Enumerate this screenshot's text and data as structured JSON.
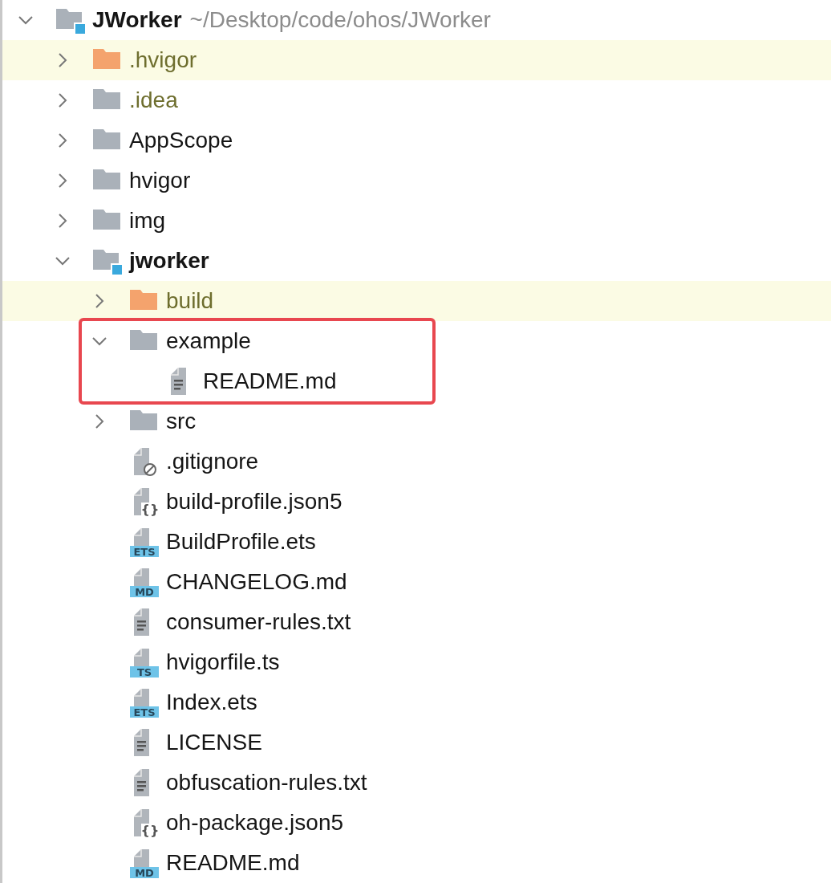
{
  "tree": {
    "name": "JWorker",
    "path": "~/Desktop/code/ohos/JWorker",
    "kind": "module",
    "excluded": false,
    "ignored": false,
    "expanded": true,
    "children": [
      {
        "name": ".hvigor",
        "kind": "folder",
        "excluded": true,
        "ignored": false,
        "expanded": false
      },
      {
        "name": ".idea",
        "kind": "folder",
        "excluded": false,
        "ignored": true,
        "expanded": false
      },
      {
        "name": "AppScope",
        "kind": "folder",
        "excluded": false,
        "ignored": false,
        "expanded": false
      },
      {
        "name": "hvigor",
        "kind": "folder",
        "excluded": false,
        "ignored": false,
        "expanded": false
      },
      {
        "name": "img",
        "kind": "folder",
        "excluded": false,
        "ignored": false,
        "expanded": false
      },
      {
        "name": "jworker",
        "kind": "module",
        "excluded": false,
        "ignored": false,
        "expanded": true,
        "children": [
          {
            "name": "build",
            "kind": "folder",
            "excluded": true,
            "ignored": false,
            "expanded": false
          },
          {
            "name": "example",
            "kind": "folder",
            "excluded": false,
            "ignored": false,
            "expanded": true,
            "boxed": true,
            "children": [
              {
                "name": "README.md",
                "kind": "textfile"
              }
            ]
          },
          {
            "name": "src",
            "kind": "folder",
            "excluded": false,
            "ignored": false,
            "expanded": false
          },
          {
            "name": ".gitignore",
            "kind": "ignorefile"
          },
          {
            "name": "build-profile.json5",
            "kind": "jsonfile",
            "badge": "{}"
          },
          {
            "name": "BuildProfile.ets",
            "kind": "codefile",
            "badge": "ETS"
          },
          {
            "name": "CHANGELOG.md",
            "kind": "codefile",
            "badge": "MD"
          },
          {
            "name": "consumer-rules.txt",
            "kind": "textfile"
          },
          {
            "name": "hvigorfile.ts",
            "kind": "codefile",
            "badge": "TS"
          },
          {
            "name": "Index.ets",
            "kind": "codefile",
            "badge": "ETS"
          },
          {
            "name": "LICENSE",
            "kind": "textfile"
          },
          {
            "name": "obfuscation-rules.txt",
            "kind": "textfile"
          },
          {
            "name": "oh-package.json5",
            "kind": "jsonfile",
            "badge": "{}"
          },
          {
            "name": "README.md",
            "kind": "codefile",
            "badge": "MD"
          }
        ]
      }
    ]
  }
}
